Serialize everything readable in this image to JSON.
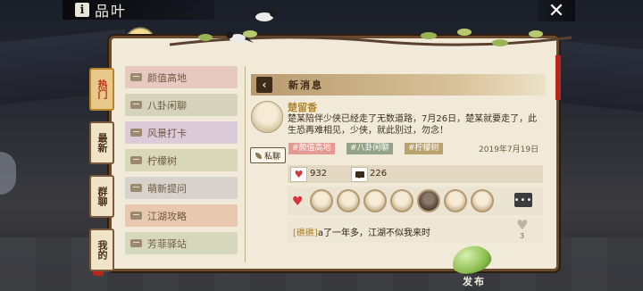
{
  "window": {
    "title": "品叶",
    "close_symbol": "✕",
    "info_symbol": "i"
  },
  "side_tabs": [
    {
      "label": "热门",
      "active": true
    },
    {
      "label": "最新",
      "active": false
    },
    {
      "label": "群聊",
      "active": false
    },
    {
      "label": "我的",
      "active": false
    }
  ],
  "categories": [
    {
      "label": "颜值高地",
      "color": "#e8c9c2"
    },
    {
      "label": "八卦闲聊",
      "color": "#d6d3bd"
    },
    {
      "label": "风景打卡",
      "color": "#dccad8"
    },
    {
      "label": "柠檬树",
      "color": "#d8d7b7"
    },
    {
      "label": "萌新提问",
      "color": "#d7d3cc"
    },
    {
      "label": "江湖攻略",
      "color": "#e8c8ae"
    },
    {
      "label": "芳菲驿站",
      "color": "#d6d8bd"
    }
  ],
  "message_panel": {
    "header_title": "新消息",
    "back_symbol": "‹",
    "post": {
      "author": "楚留香",
      "body": "楚某陪伴少侠已经走了无数道路，7月26日，楚某就要走了，此生恐再难相见，少侠，就此别过，勿念！",
      "tags": [
        {
          "label": "#颜值高地",
          "color": "#e29a93"
        },
        {
          "label": "#八卦闲聊",
          "color": "#94a388"
        },
        {
          "label": "#柠檬树",
          "color": "#b9a36e"
        }
      ],
      "date": "2019年7月19日",
      "private_chat_label": "私聊",
      "likes": "932",
      "comments": "226"
    },
    "likers_count_shown": 7,
    "more_label": "•••",
    "comment": {
      "user": "[礁礁]",
      "text": "a了一年多，江湖不似我来时",
      "likes": "3"
    }
  },
  "publish_label": "发布",
  "colors": {
    "heart": "#d8323c",
    "accent_text": "#b0852e",
    "frame": "#6a4a2e"
  }
}
